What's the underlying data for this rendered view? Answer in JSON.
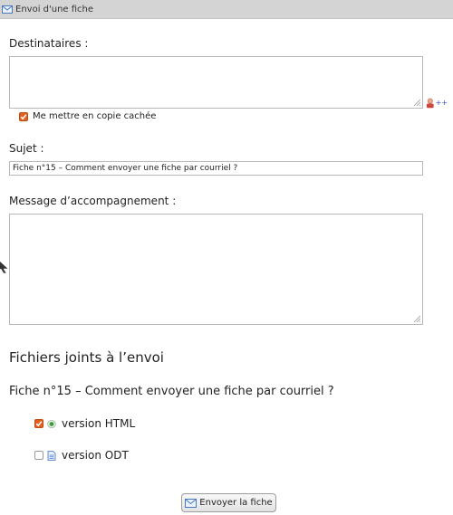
{
  "window": {
    "title": "Envoi d'une fiche",
    "title_icon": "mail-icon"
  },
  "recipients": {
    "label": "Destinataires :",
    "value": "",
    "add_icon": "add-user-icon",
    "add_label": "++"
  },
  "bcc": {
    "label": "Me mettre en copie cachée",
    "checked": true
  },
  "subject": {
    "label": "Sujet :",
    "value": "Fiche n°15 – Comment envoyer une fiche par courriel ?"
  },
  "message": {
    "label": "Message d’accompagnement :",
    "value": ""
  },
  "attachments": {
    "heading": "Fichiers joints à l’envoi",
    "fiche_title": "Fiche n°15 – Comment envoyer une fiche par courriel ?",
    "items": [
      {
        "label": "version HTML",
        "checked": true,
        "icon": "html-globe-icon"
      },
      {
        "label": "version ODT",
        "checked": false,
        "icon": "odt-document-icon"
      }
    ]
  },
  "actions": {
    "send_label": "Envoyer la fiche",
    "send_icon": "mail-icon"
  },
  "colors": {
    "titlebar": "#d4d4d4",
    "checkbox_on": "#e06020",
    "border": "#b9b9b9"
  }
}
